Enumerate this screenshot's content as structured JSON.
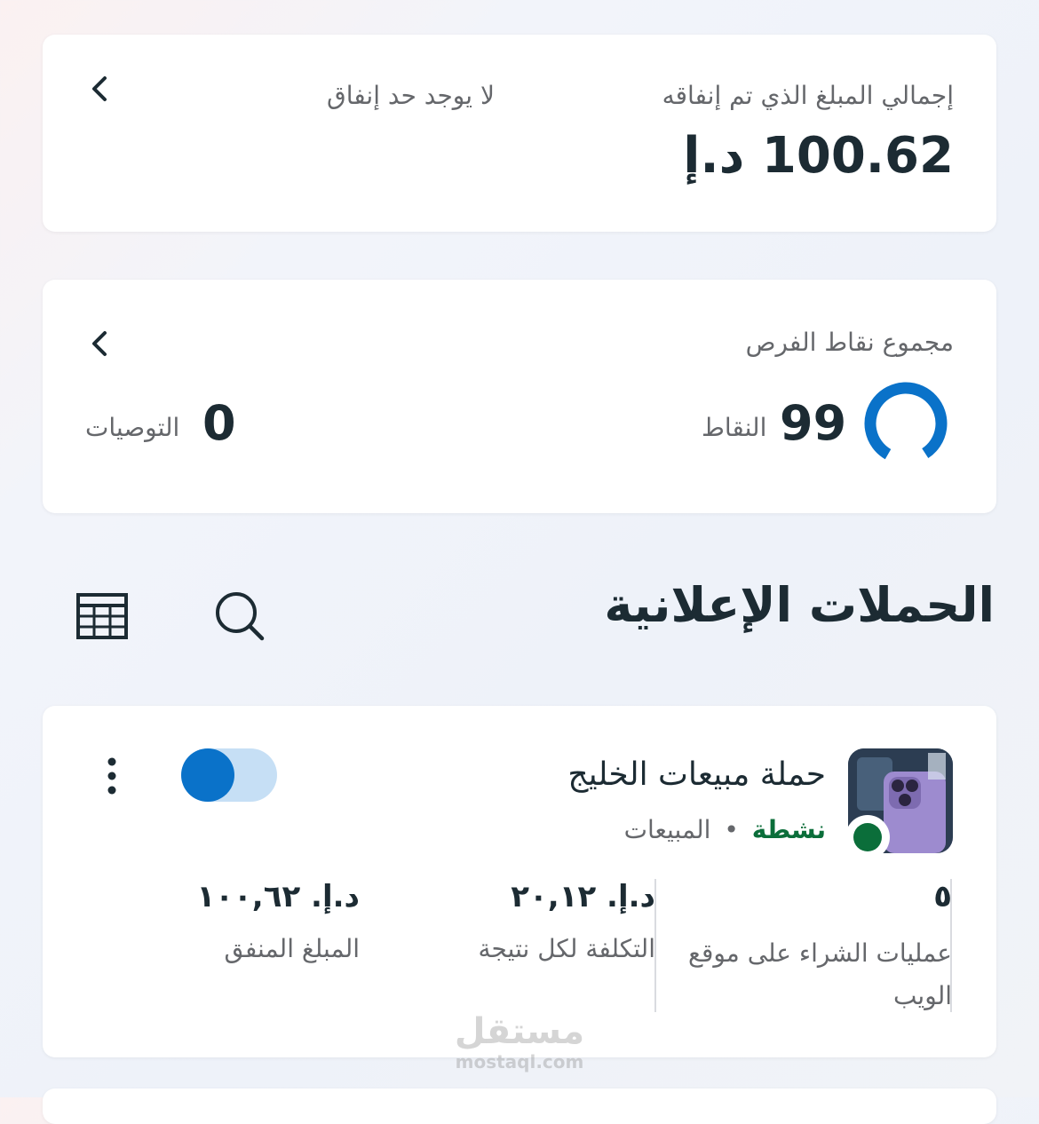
{
  "spend_card": {
    "label": "إجمالي المبلغ الذي تم إنفاقه",
    "amount": "100.62 د.إ",
    "limit_text": "لا يوجد حد إنفاق"
  },
  "opportunity_card": {
    "label": "مجموع نقاط الفرص",
    "score": "99",
    "score_unit": "النقاط",
    "score_fraction": 0.99,
    "recommendations_count": "0",
    "recommendations_label": "التوصيات"
  },
  "section": {
    "title": "الحملات الإعلانية"
  },
  "campaign": {
    "name": "حملة مبيعات الخليج",
    "status": "نشطة",
    "separator": "•",
    "objective": "المبيعات",
    "toggle_on": true,
    "metrics": [
      {
        "value": "٥",
        "label": "عمليات الشراء على موقع الويب"
      },
      {
        "value": "د.إ. ٢٠,١٢",
        "label": "التكلفة لكل نتيجة"
      },
      {
        "value": "د.إ. ١٠٠,٦٢",
        "label": "المبلغ المنفق"
      }
    ]
  },
  "watermark": {
    "arabic": "مستقل",
    "latin": "mostaql.com"
  },
  "colors": {
    "accent": "#0a72c9",
    "toggle_track": "#c6dff5",
    "status_green": "#0b6e3a",
    "text_primary": "#1c2b33",
    "text_secondary": "#65676b"
  },
  "icons": {
    "chevron": "chevron-left-icon",
    "search": "search-icon",
    "table": "table-icon",
    "more": "more-vertical-icon",
    "status_dot": "status-dot-icon"
  }
}
